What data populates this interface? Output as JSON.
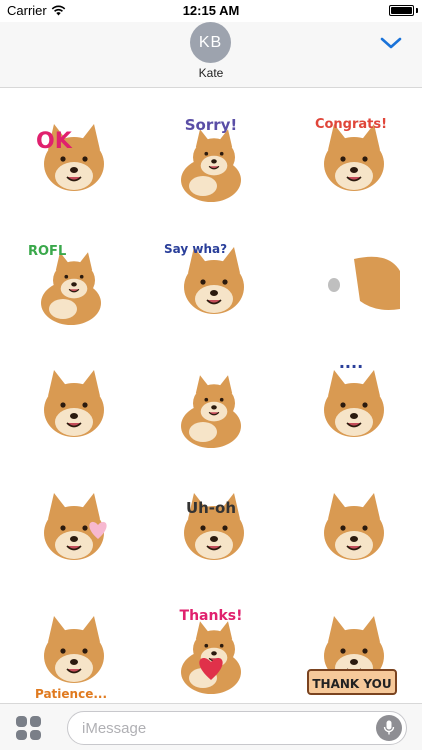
{
  "status_bar": {
    "carrier": "Carrier",
    "time": "12:15 AM"
  },
  "header": {
    "avatar_initials": "KB",
    "contact_name": "Kate"
  },
  "stickers": [
    {
      "caption": "OK",
      "caption_color": "#e0216e"
    },
    {
      "caption": "Sorry!",
      "caption_color": "#5a4ea6"
    },
    {
      "caption": "Congrats!",
      "caption_color": "#e0463a"
    },
    {
      "caption": "ROFL",
      "caption_color": "#3aa84b"
    },
    {
      "caption": "Say wha?",
      "caption_color": "#2a3f9a"
    },
    {
      "caption": "",
      "caption_color": ""
    },
    {
      "caption": "",
      "caption_color": ""
    },
    {
      "caption": "",
      "caption_color": ""
    },
    {
      "caption": "....",
      "caption_color": "#2a3f9a"
    },
    {
      "caption": "",
      "caption_color": ""
    },
    {
      "caption": "Uh-oh",
      "caption_color": "#333333"
    },
    {
      "caption": "",
      "caption_color": ""
    },
    {
      "caption": "Patience...",
      "caption_color": "#e07a1f"
    },
    {
      "caption": "Thanks!",
      "caption_color": "#e0216e"
    },
    {
      "caption": "THANK YOU",
      "caption_color": "#222222"
    }
  ],
  "message_input": {
    "placeholder": "iMessage"
  },
  "colors": {
    "chevron": "#1a73d9",
    "dog_fur": "#d99a52",
    "dog_light": "#f6e4c8"
  }
}
